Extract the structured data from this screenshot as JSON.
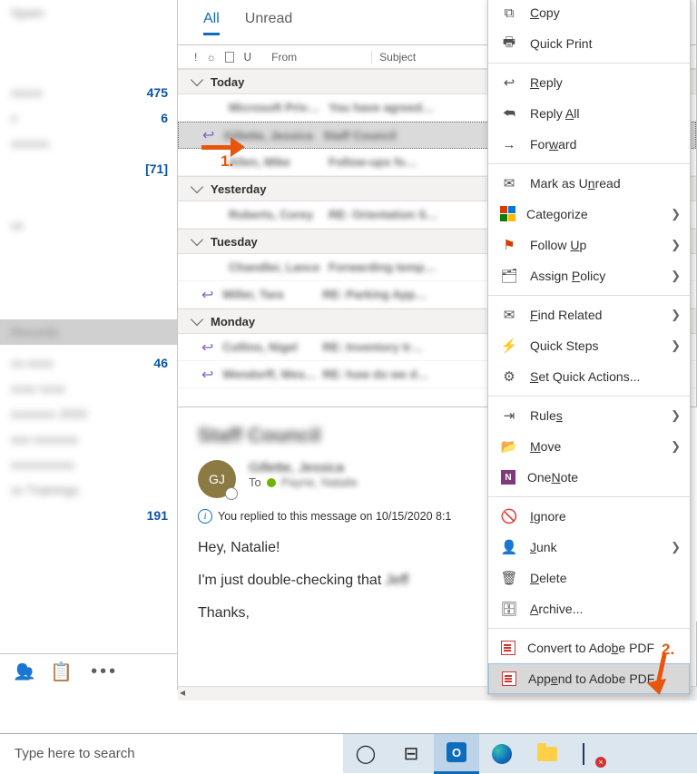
{
  "sidebar": {
    "items": [
      {
        "name": "Spam"
      },
      {
        "name": ""
      },
      {
        "name": "",
        "count": "475"
      },
      {
        "name": "",
        "count": "6"
      },
      {
        "name": ""
      },
      {
        "name": "",
        "bracket": "[71]"
      },
      {
        "name": ""
      },
      {
        "name": ""
      },
      {
        "name": "",
        "selected": true
      },
      {
        "name": ""
      },
      {
        "name": "",
        "count": "46"
      },
      {
        "name": ""
      },
      {
        "name": ""
      },
      {
        "name": ""
      },
      {
        "name": ""
      },
      {
        "name": ""
      },
      {
        "name": "",
        "count": "191"
      }
    ]
  },
  "tabs": {
    "all": "All",
    "unread": "Unread"
  },
  "columns": {
    "from": "From",
    "subject": "Subject"
  },
  "groups": {
    "today": "Today",
    "yesterday": "Yesterday",
    "tuesday": "Tuesday",
    "monday": "Monday"
  },
  "messages": {
    "today": [
      {
        "from": "Microsoft Priv…",
        "subj": "You have agreed…"
      },
      {
        "from": "Gillette, Jessica",
        "subj": "Staff Council",
        "reply": true,
        "selected": true
      },
      {
        "from": "Allen, Mike",
        "subj": "Follow-ups fo…"
      }
    ],
    "yesterday": [
      {
        "from": "Roberts, Corey",
        "subj": "RE: Orientation S…"
      }
    ],
    "tuesday": [
      {
        "from": "Chandler, Lance",
        "subj": "Forwarding temp…"
      },
      {
        "from": "Miller, Tara",
        "subj": "RE: Parking App…",
        "reply": true
      }
    ],
    "monday": [
      {
        "from": "Collins, Nigel",
        "subj": "RE: Inventory tr…",
        "reply": true
      },
      {
        "from": "Wendorff, Wes…",
        "subj": "RE: how do we d…",
        "reply": true
      }
    ]
  },
  "reading": {
    "subject": "Staff Council",
    "avatar": "GJ",
    "from": "Gillette, Jessica",
    "to_label": "To",
    "to_name": "Payne, Natalie",
    "info": "You replied to this message on 10/15/2020 8:1",
    "greeting": "Hey, Natalie!",
    "body_1": "I'm just double-checking that",
    "body_1_blur": "Jeff",
    "body_2": "Thanks,"
  },
  "context_menu": {
    "copy": "Copy",
    "copy_u": "C",
    "quick_print": "Quick Print",
    "reply": "Reply",
    "reply_u": "R",
    "reply_all": "Reply All",
    "reply_all_u": "A",
    "forward": "Forward",
    "forward_u": "w",
    "mark_unread": "Mark as Unread",
    "mark_unread_u": "n",
    "categorize": "Categorize",
    "follow_up": "Follow Up",
    "follow_up_u": "U",
    "assign_policy": "Assign Policy",
    "assign_policy_u": "P",
    "find_related": "Find Related",
    "find_related_u": "F",
    "quick_steps": "Quick Steps",
    "set_quick_actions": "Set Quick Actions...",
    "sqa_u": "S",
    "rules": "Rules",
    "rules_u": "s",
    "move": "Move",
    "move_u": "M",
    "onenote": "OneNote",
    "onenote_u": "N",
    "ignore": "Ignore",
    "ignore_u": "I",
    "junk": "Junk",
    "junk_u": "J",
    "delete": "Delete",
    "delete_u": "D",
    "archive": "Archive...",
    "archive_u": "A",
    "convert_pdf": "Convert to Adobe PDF",
    "convert_pdf_u": "b",
    "append_pdf": "Append to Adobe PDF",
    "append_pdf_u": "e"
  },
  "callouts": {
    "one": "1.",
    "two": "2."
  },
  "taskbar": {
    "search_placeholder": "Type here to search"
  }
}
